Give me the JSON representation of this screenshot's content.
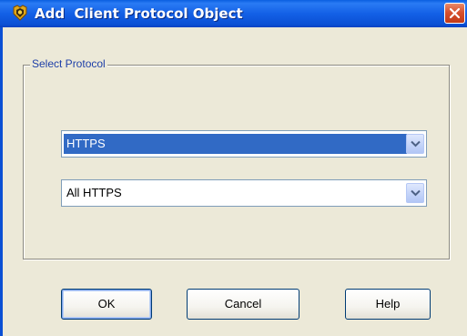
{
  "window": {
    "title": "Add  Client Protocol Object",
    "icon": "gold-badge-icon",
    "close_icon": "close-icon"
  },
  "group": {
    "label": "Select Protocol"
  },
  "protocol_select": {
    "selected": "HTTPS"
  },
  "subtype_select": {
    "selected": "All HTTPS"
  },
  "buttons": {
    "ok": "OK",
    "cancel": "Cancel",
    "help": "Help"
  },
  "colors": {
    "title_bar": "#0b50d4",
    "selection": "#316ac5",
    "close": "#d6512f",
    "group_label": "#1e3fa8"
  }
}
